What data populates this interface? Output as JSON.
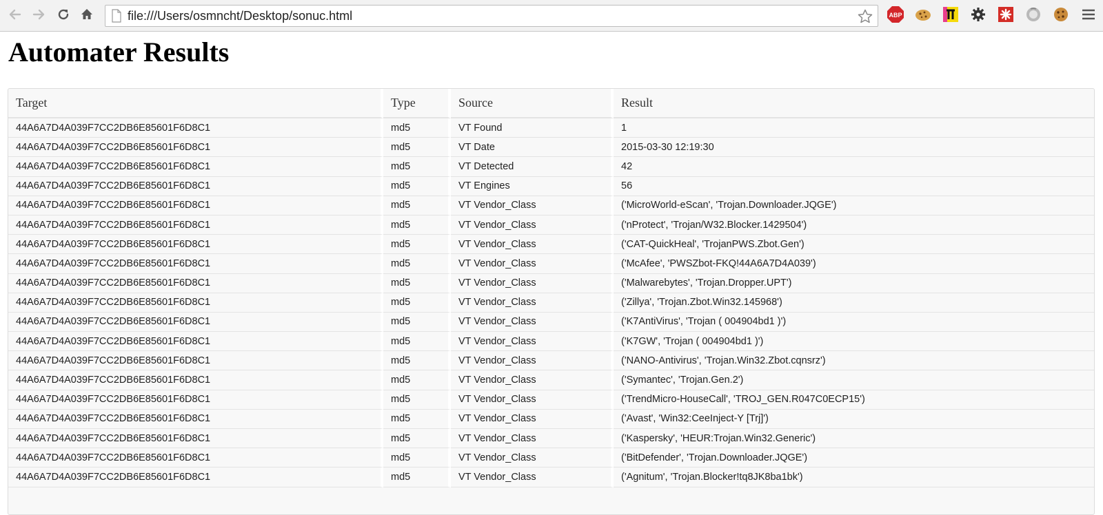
{
  "browser": {
    "url": "file:///Users/osmncht/Desktop/sonuc.html",
    "nav_icons": [
      "back-arrow-icon",
      "forward-arrow-icon",
      "reload-icon",
      "home-icon"
    ],
    "extension_icons": [
      "adblock-plus-icon",
      "cookie-icon",
      "pi-extension-icon",
      "settings-gear-icon",
      "lastpass-icon",
      "ghostery-icon",
      "cookie-icon"
    ],
    "extensions": {
      "abp_label": "ABP"
    }
  },
  "page": {
    "title": "Automater Results"
  },
  "table": {
    "headers": [
      "Target",
      "Type",
      "Source",
      "Result"
    ],
    "rows": [
      [
        "44A6A7D4A039F7CC2DB6E85601F6D8C1",
        "md5",
        "VT Found",
        "1"
      ],
      [
        "44A6A7D4A039F7CC2DB6E85601F6D8C1",
        "md5",
        "VT Date",
        "2015-03-30 12:19:30"
      ],
      [
        "44A6A7D4A039F7CC2DB6E85601F6D8C1",
        "md5",
        "VT Detected",
        "42"
      ],
      [
        "44A6A7D4A039F7CC2DB6E85601F6D8C1",
        "md5",
        "VT Engines",
        "56"
      ],
      [
        "44A6A7D4A039F7CC2DB6E85601F6D8C1",
        "md5",
        "VT Vendor_Class",
        "('MicroWorld-eScan', 'Trojan.Downloader.JQGE')"
      ],
      [
        "44A6A7D4A039F7CC2DB6E85601F6D8C1",
        "md5",
        "VT Vendor_Class",
        "('nProtect', 'Trojan/W32.Blocker.1429504')"
      ],
      [
        "44A6A7D4A039F7CC2DB6E85601F6D8C1",
        "md5",
        "VT Vendor_Class",
        "('CAT-QuickHeal', 'TrojanPWS.Zbot.Gen')"
      ],
      [
        "44A6A7D4A039F7CC2DB6E85601F6D8C1",
        "md5",
        "VT Vendor_Class",
        "('McAfee', 'PWSZbot-FKQ!44A6A7D4A039')"
      ],
      [
        "44A6A7D4A039F7CC2DB6E85601F6D8C1",
        "md5",
        "VT Vendor_Class",
        "('Malwarebytes', 'Trojan.Dropper.UPT')"
      ],
      [
        "44A6A7D4A039F7CC2DB6E85601F6D8C1",
        "md5",
        "VT Vendor_Class",
        "('Zillya', 'Trojan.Zbot.Win32.145968')"
      ],
      [
        "44A6A7D4A039F7CC2DB6E85601F6D8C1",
        "md5",
        "VT Vendor_Class",
        "('K7AntiVirus', 'Trojan ( 004904bd1 )')"
      ],
      [
        "44A6A7D4A039F7CC2DB6E85601F6D8C1",
        "md5",
        "VT Vendor_Class",
        "('K7GW', 'Trojan ( 004904bd1 )')"
      ],
      [
        "44A6A7D4A039F7CC2DB6E85601F6D8C1",
        "md5",
        "VT Vendor_Class",
        "('NANO-Antivirus', 'Trojan.Win32.Zbot.cqnsrz')"
      ],
      [
        "44A6A7D4A039F7CC2DB6E85601F6D8C1",
        "md5",
        "VT Vendor_Class",
        "('Symantec', 'Trojan.Gen.2')"
      ],
      [
        "44A6A7D4A039F7CC2DB6E85601F6D8C1",
        "md5",
        "VT Vendor_Class",
        "('TrendMicro-HouseCall', 'TROJ_GEN.R047C0ECP15')"
      ],
      [
        "44A6A7D4A039F7CC2DB6E85601F6D8C1",
        "md5",
        "VT Vendor_Class",
        "('Avast', 'Win32:CeeInject-Y [Trj]')"
      ],
      [
        "44A6A7D4A039F7CC2DB6E85601F6D8C1",
        "md5",
        "VT Vendor_Class",
        "('Kaspersky', 'HEUR:Trojan.Win32.Generic')"
      ],
      [
        "44A6A7D4A039F7CC2DB6E85601F6D8C1",
        "md5",
        "VT Vendor_Class",
        "('BitDefender', 'Trojan.Downloader.JQGE')"
      ],
      [
        "44A6A7D4A039F7CC2DB6E85601F6D8C1",
        "md5",
        "VT Vendor_Class",
        "('Agnitum', 'Trojan.Blocker!tq8JK8ba1bk')"
      ]
    ]
  }
}
